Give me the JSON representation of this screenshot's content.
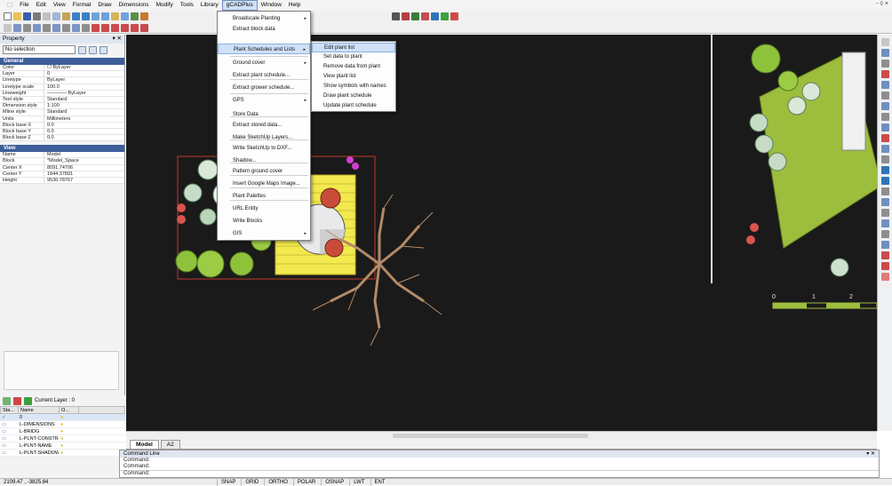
{
  "menubar": {
    "items": [
      {
        "label": "File"
      },
      {
        "label": "Edit"
      },
      {
        "label": "View"
      },
      {
        "label": "Format"
      },
      {
        "label": "Draw"
      },
      {
        "label": "Dimensions"
      },
      {
        "label": "Modify"
      },
      {
        "label": "Tools"
      },
      {
        "label": "Library"
      },
      {
        "label": "gCADPlus"
      },
      {
        "label": "Window"
      },
      {
        "label": "Help"
      }
    ],
    "window_controls": "- ◊ ×"
  },
  "property_panel": {
    "title": "Property",
    "selection": "No selection",
    "general_title": "General",
    "general": [
      {
        "k": "Color",
        "v": "☐ ByLayer"
      },
      {
        "k": "Layer",
        "v": "0"
      },
      {
        "k": "Linetype",
        "v": "ByLayer"
      },
      {
        "k": "Linetype scale",
        "v": "100.0"
      },
      {
        "k": "Lineweight",
        "v": "———— ByLayer"
      },
      {
        "k": "Text style",
        "v": "Standard"
      },
      {
        "k": "Dimension style",
        "v": "1:100"
      },
      {
        "k": "Mline style",
        "v": "Standard"
      },
      {
        "k": "Units",
        "v": "Millimeters"
      },
      {
        "k": "Block base X",
        "v": "0.0"
      },
      {
        "k": "Block base Y",
        "v": "0.0"
      },
      {
        "k": "Block base Z",
        "v": "0.0"
      }
    ],
    "view_title": "View",
    "view": [
      {
        "k": "Name",
        "v": "Model"
      },
      {
        "k": "Block",
        "v": "*Model_Space"
      },
      {
        "k": "Center X",
        "v": "8091.74706"
      },
      {
        "k": "Center Y",
        "v": "1844.37891"
      },
      {
        "k": "Height",
        "v": "9530.78767"
      }
    ]
  },
  "layer_panel": {
    "current_layer": "Current Layer : 0",
    "columns": [
      "Sta...",
      "Name",
      "O..."
    ],
    "rows": [
      {
        "name": "0"
      },
      {
        "name": "L-DIMENSIONS"
      },
      {
        "name": "L-BRIDG"
      },
      {
        "name": "L-PLNT-CONSTR"
      },
      {
        "name": "L-PLNT-NAME"
      },
      {
        "name": "L-PLNT-SHADOW"
      }
    ]
  },
  "gcad_menu": {
    "items": [
      {
        "label": "Broadscale Planting",
        "arrow": "▸"
      },
      {
        "label": "Extract block data",
        "arrow": ""
      },
      {
        "label": "Plant Schedules and Lists",
        "arrow": "▸",
        "highlight": true
      },
      {
        "label": "Ground cover",
        "arrow": "▸"
      },
      {
        "label": "Extract plant schedule...",
        "arrow": ""
      },
      {
        "label": "Extract grower schedule...",
        "arrow": ""
      },
      {
        "label": "GPS",
        "arrow": "▸"
      },
      {
        "label": "Store Data",
        "arrow": ""
      },
      {
        "label": "Extract stored data...",
        "arrow": ""
      },
      {
        "label": "Make SketchUp Layers...",
        "arrow": ""
      },
      {
        "label": "Write SketchUp to DXF...",
        "arrow": ""
      },
      {
        "label": "Shadow...",
        "arrow": ""
      },
      {
        "label": "Pattern ground cover",
        "arrow": ""
      },
      {
        "label": "Insert Google Maps Image...",
        "arrow": ""
      },
      {
        "label": "Plant Palettes",
        "arrow": ""
      },
      {
        "label": "URL Entity",
        "arrow": ""
      },
      {
        "label": "Write Blocks",
        "arrow": ""
      },
      {
        "label": "GIS",
        "arrow": "▸"
      }
    ]
  },
  "plant_submenu": {
    "items": [
      {
        "label": "Edit plant list",
        "highlight": true
      },
      {
        "label": "Set data to plant"
      },
      {
        "label": "Remove data from plant"
      },
      {
        "label": "View plant list"
      },
      {
        "label": "Show symbols with names"
      },
      {
        "label": "Draw plant schedule"
      },
      {
        "label": "Update plant schedule"
      }
    ]
  },
  "drawing": {
    "scale_labels": [
      "0",
      "1",
      "2"
    ]
  },
  "tabs": {
    "model": "Model",
    "layout": "A2"
  },
  "command_panel": {
    "title": "Command Line",
    "lines": [
      "Command:",
      "Command:",
      "Command:"
    ]
  },
  "status": {
    "coords": "2109.47 , -3825.84",
    "buttons": [
      "SNAP",
      "GRID",
      "ORTHO",
      "POLAR",
      "OSNAP",
      "LWT",
      "ENT"
    ]
  }
}
